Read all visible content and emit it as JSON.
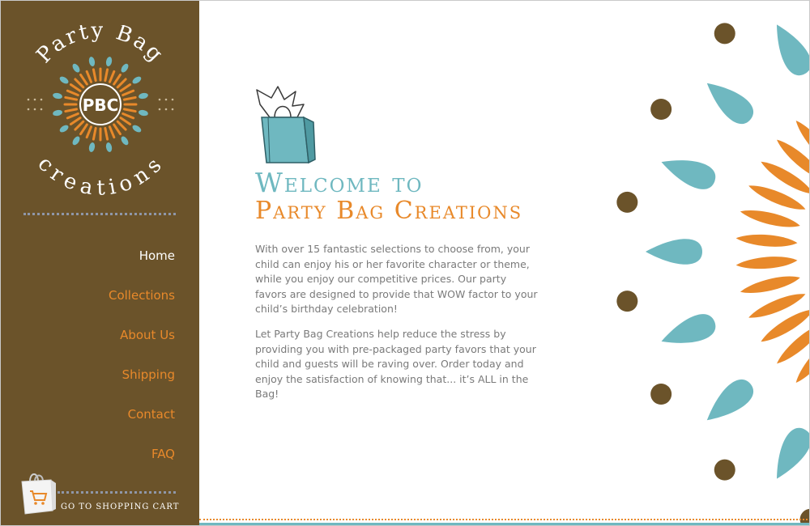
{
  "brand": {
    "logo_top_text": "Party Bag",
    "logo_monogram": "PBC",
    "logo_bottom_text": "creations"
  },
  "nav": {
    "items": [
      {
        "label": "Home",
        "active": true
      },
      {
        "label": "Collections",
        "active": false
      },
      {
        "label": "About Us",
        "active": false
      },
      {
        "label": "Shipping",
        "active": false
      },
      {
        "label": "Contact",
        "active": false
      },
      {
        "label": "FAQ",
        "active": false
      }
    ]
  },
  "cart": {
    "label": "Go to Shopping Cart"
  },
  "hero": {
    "title_line1": "Welcome to",
    "title_line2": "Party Bag Creations",
    "paragraphs": [
      "With over 15 fantastic selections to choose from, your child can enjoy his or her favorite character or theme, while you enjoy our competitive prices. Our party favors are designed to provide that WOW factor to your child’s birthday celebration!",
      "Let Party Bag Creations help reduce the stress by providing you with pre-packaged party favors that your child and guests will be raving over. Order today and enjoy the satisfaction of knowing that... it’s ALL in the Bag!"
    ]
  },
  "colors": {
    "sidebar_brown": "#6b532a",
    "accent_orange": "#e8892a",
    "accent_teal": "#6fb8c0",
    "dot_brown": "#6b532a",
    "body_text": "#7a7a7a"
  },
  "icons": [
    "party-bag-logo-icon",
    "gift-bag-icon",
    "shopping-cart-bag-icon"
  ]
}
